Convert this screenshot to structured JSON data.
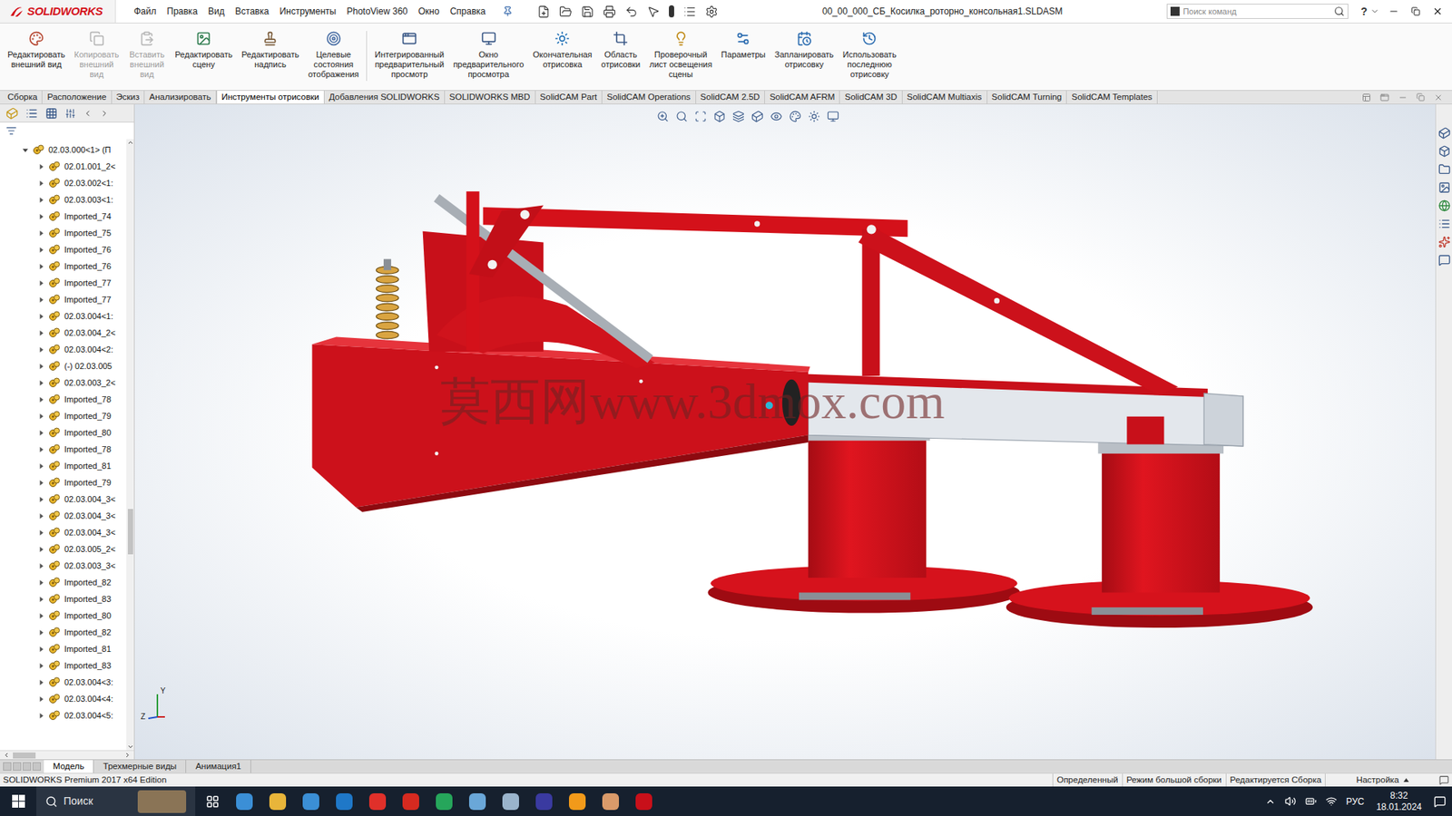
{
  "window": {
    "title": "00_00_000_СБ_Косилка_роторно_консольная1.SLDASM"
  },
  "app": {
    "logo": "SOLIDWORKS"
  },
  "menu": [
    "Файл",
    "Правка",
    "Вид",
    "Вставка",
    "Инструменты",
    "PhotoView 360",
    "Окно",
    "Справка"
  ],
  "search": {
    "placeholder": "Поиск команд"
  },
  "help": "?",
  "ribbon": [
    {
      "lines": [
        "Редактировать",
        "внешний вид"
      ],
      "disabled": false
    },
    {
      "lines": [
        "Копировать",
        "внешний",
        "вид"
      ],
      "disabled": true
    },
    {
      "lines": [
        "Вставить",
        "внешний",
        "вид"
      ],
      "disabled": true
    },
    {
      "lines": [
        "Редактировать",
        "сцену"
      ],
      "disabled": false
    },
    {
      "lines": [
        "Редактировать",
        "надпись"
      ],
      "disabled": false
    },
    {
      "lines": [
        "Целевые",
        "состояния",
        "отображения"
      ],
      "disabled": false
    },
    {
      "lines": [
        "Интегрированный",
        "предварительный",
        "просмотр"
      ],
      "disabled": false
    },
    {
      "lines": [
        "Окно",
        "предварительного",
        "просмотра"
      ],
      "disabled": false
    },
    {
      "lines": [
        "Окончательная",
        "отрисовка"
      ],
      "disabled": false
    },
    {
      "lines": [
        "Область",
        "отрисовки"
      ],
      "disabled": false
    },
    {
      "lines": [
        "Проверочный",
        "лист освещения",
        "сцены"
      ],
      "disabled": false
    },
    {
      "lines": [
        "Параметры"
      ],
      "disabled": false
    },
    {
      "lines": [
        "Запланировать",
        "отрисовку"
      ],
      "disabled": false
    },
    {
      "lines": [
        "Использовать",
        "последнюю",
        "отрисовку"
      ],
      "disabled": false
    }
  ],
  "command_tabs": [
    {
      "label": "Сборка",
      "selected": false
    },
    {
      "label": "Расположение",
      "selected": false
    },
    {
      "label": "Эскиз",
      "selected": false
    },
    {
      "label": "Анализировать",
      "selected": false
    },
    {
      "label": "Инструменты отрисовки",
      "selected": true
    },
    {
      "label": "Добавления SOLIDWORKS",
      "selected": false
    },
    {
      "label": "SOLIDWORKS MBD",
      "selected": false
    },
    {
      "label": "SolidCAM Part",
      "selected": false
    },
    {
      "label": "SolidCAM Operations",
      "selected": false
    },
    {
      "label": "SolidCAM 2.5D",
      "selected": false
    },
    {
      "label": "SolidCAM AFRM",
      "selected": false
    },
    {
      "label": "SolidCAM 3D",
      "selected": false
    },
    {
      "label": "SolidCAM Multiaxis",
      "selected": false
    },
    {
      "label": "SolidCAM Turning",
      "selected": false
    },
    {
      "label": "SolidCAM Templates",
      "selected": false
    }
  ],
  "tree": {
    "root": {
      "label": "02.03.000<1> (П",
      "expanded": true
    },
    "items": [
      {
        "label": "02.01.001_2<",
        "expanded": false
      },
      {
        "label": "02.03.002<1:",
        "expanded": false
      },
      {
        "label": "02.03.003<1:",
        "expanded": false
      },
      {
        "label": "Imported_74",
        "expanded": false
      },
      {
        "label": "Imported_75",
        "expanded": false
      },
      {
        "label": "Imported_76",
        "expanded": false
      },
      {
        "label": "Imported_76",
        "expanded": false
      },
      {
        "label": "Imported_77",
        "expanded": false
      },
      {
        "label": "Imported_77",
        "expanded": false
      },
      {
        "label": "02.03.004<1:",
        "expanded": false
      },
      {
        "label": "02.03.004_2<",
        "expanded": false
      },
      {
        "label": "02.03.004<2:",
        "expanded": false
      },
      {
        "label": "(-) 02.03.005",
        "expanded": false
      },
      {
        "label": "02.03.003_2<",
        "expanded": false
      },
      {
        "label": "Imported_78",
        "expanded": false
      },
      {
        "label": "Imported_79",
        "expanded": false
      },
      {
        "label": "Imported_80",
        "expanded": false
      },
      {
        "label": "Imported_78",
        "expanded": false
      },
      {
        "label": "Imported_81",
        "expanded": false
      },
      {
        "label": "Imported_79",
        "expanded": false
      },
      {
        "label": "02.03.004_3<",
        "expanded": false
      },
      {
        "label": "02.03.004_3<",
        "expanded": false
      },
      {
        "label": "02.03.004_3<",
        "expanded": false
      },
      {
        "label": "02.03.005_2<",
        "expanded": false
      },
      {
        "label": "02.03.003_3<",
        "expanded": false
      },
      {
        "label": "Imported_82",
        "expanded": false
      },
      {
        "label": "Imported_83",
        "expanded": false
      },
      {
        "label": "Imported_80",
        "expanded": false
      },
      {
        "label": "Imported_82",
        "expanded": false
      },
      {
        "label": "Imported_81",
        "expanded": false
      },
      {
        "label": "Imported_83",
        "expanded": false
      },
      {
        "label": "02.03.004<3:",
        "expanded": false
      },
      {
        "label": "02.03.004<4:",
        "expanded": false
      },
      {
        "label": "02.03.004<5:",
        "expanded": false
      }
    ]
  },
  "viewport": {
    "watermark": "莫西网www.3dmox.com",
    "axes": {
      "y": "Y",
      "z": "Z"
    }
  },
  "bottom_tabs": [
    {
      "label": "Модель",
      "selected": true
    },
    {
      "label": "Трехмерные виды",
      "selected": false
    },
    {
      "label": "Анимация1",
      "selected": false
    }
  ],
  "status_bar": {
    "edition": "SOLIDWORKS Premium 2017 x64 Edition",
    "fields": [
      "Определенный",
      "Режим большой сборки",
      "Редактируется Сборка",
      "Настройка"
    ]
  },
  "taskbar": {
    "search": "Поиск",
    "language": "РУС",
    "time": "8:32",
    "date": "18.01.2024"
  }
}
